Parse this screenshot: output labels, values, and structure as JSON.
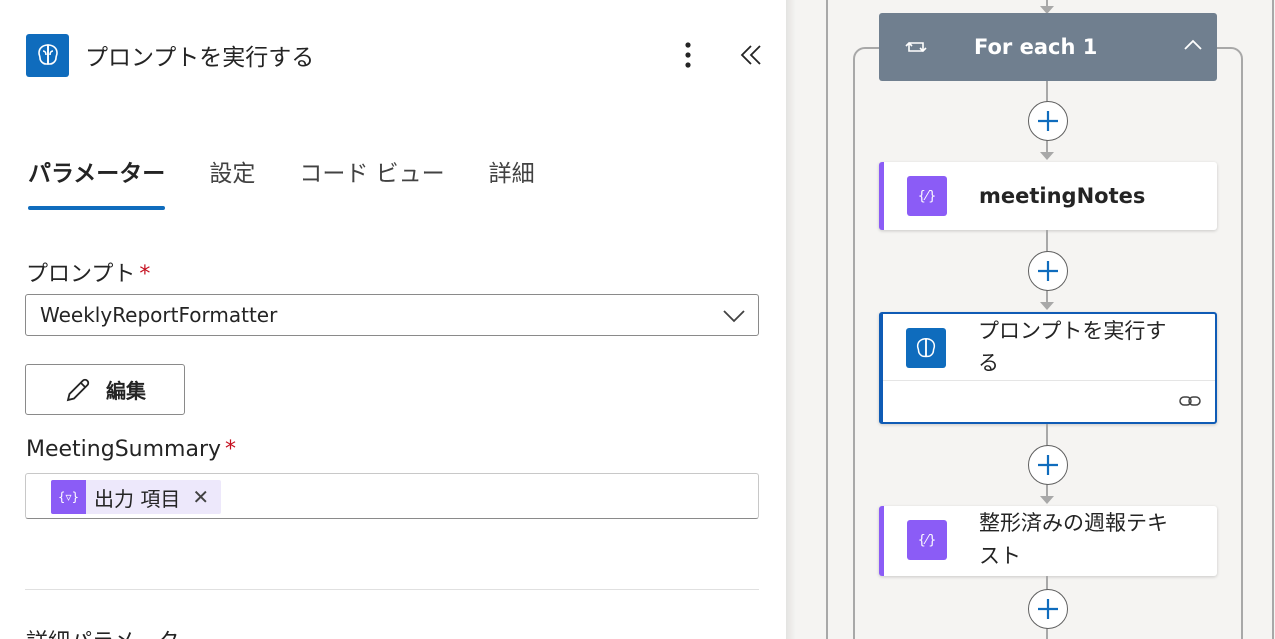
{
  "panel": {
    "title": "プロンプトを実行する",
    "more_icon": "more-vertical-icon",
    "collapse_icon": "double-chevron-left-icon"
  },
  "tabs": [
    {
      "label": "パラメーター",
      "active": true
    },
    {
      "label": "設定",
      "active": false
    },
    {
      "label": "コード ビュー",
      "active": false
    },
    {
      "label": "詳細",
      "active": false
    }
  ],
  "prompt_field": {
    "label": "プロンプト",
    "required_mark": "*",
    "value": "WeeklyReportFormatter"
  },
  "edit_button": {
    "label": "編集",
    "icon": "pencil-icon"
  },
  "meeting_summary": {
    "label": "MeetingSummary",
    "required_mark": "*",
    "token_label": "出力 項目",
    "token_icon_text": "{▿}",
    "remove": "✕"
  },
  "advanced": {
    "label": "詳細パラメーター"
  },
  "canvas": {
    "foreach_title": "For each 1",
    "nodes": [
      {
        "title": "meetingNotes",
        "icon_text": "{⁄}"
      },
      {
        "title_line1": "プロンプトを実行す",
        "title_line2": "る"
      },
      {
        "title_line1": "整形済みの週報テキ",
        "title_line2": "スト",
        "icon_text": "{⁄}"
      }
    ]
  },
  "colors": {
    "accent": "#0f6cbd",
    "variable": "#8b5cf6",
    "loop": "#707f8f"
  }
}
